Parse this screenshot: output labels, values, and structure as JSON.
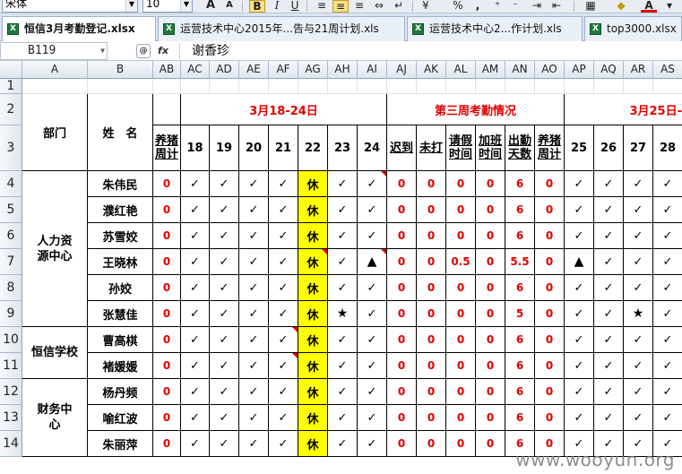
{
  "toolbar": {
    "font_name": "宋体",
    "font_size": "10",
    "grow_font": "A",
    "shrink_font": "A",
    "bold": "B",
    "percent": "%",
    "thousands": ",",
    "font_color_letter": "A"
  },
  "tabs": [
    {
      "label": "恒信3月考勤登记.xlsx",
      "active": true
    },
    {
      "label": "运营技术中心2015年...告与21周计划.xls",
      "active": false
    },
    {
      "label": "运营技术中心2...作计划.xls",
      "active": false
    },
    {
      "label": "top3000.xlsx",
      "active": false
    }
  ],
  "formula_bar": {
    "name_box": "B119",
    "fx_label": "fx",
    "content": "谢香珍"
  },
  "columns": [
    "A",
    "B",
    "AB",
    "AC",
    "AD",
    "AE",
    "AF",
    "AG",
    "AH",
    "AI",
    "AJ",
    "AK",
    "AL",
    "AM",
    "AN",
    "AO",
    "AP",
    "AQ",
    "AR",
    "AS"
  ],
  "rows": [
    "1",
    "2",
    "3",
    "4",
    "5",
    "6",
    "7",
    "8",
    "9",
    "10",
    "11",
    "12",
    "13",
    "14"
  ],
  "sheet": {
    "header_dept": "部门",
    "header_name": "姓　名",
    "week3_dates": "3月18-24日",
    "week3_summary": "第三周考勤情况",
    "week4_dates": "3月25日-",
    "col_labels": {
      "ab": "养猪周计",
      "ao": "养猪周计",
      "aj": "迟到",
      "ak": "未打",
      "al": "请假时间",
      "am": "加班时间",
      "an": "出勤天数"
    },
    "days_week3": [
      "18",
      "19",
      "20",
      "21",
      "22",
      "23",
      "24"
    ],
    "days_week4": [
      "25",
      "26",
      "27",
      "28"
    ],
    "departments": [
      {
        "label": "人力资源中心"
      },
      {
        "label": "恒信学校"
      },
      {
        "label": "财务中心"
      }
    ],
    "employees": [
      {
        "name": "朱伟民",
        "ab": "0",
        "w3": [
          "✓",
          "✓",
          "✓",
          "✓",
          "休",
          "✓",
          "✓"
        ],
        "aj": "0",
        "ak": "0",
        "al": "0",
        "am": "0",
        "an": "6",
        "ao": "0",
        "w4": [
          "✓",
          "✓",
          "✓",
          "✓"
        ]
      },
      {
        "name": "濮红艳",
        "ab": "0",
        "w3": [
          "✓",
          "✓",
          "✓",
          "✓",
          "休",
          "✓",
          "✓"
        ],
        "aj": "0",
        "ak": "0",
        "al": "0",
        "am": "0",
        "an": "6",
        "ao": "0",
        "w4": [
          "✓",
          "✓",
          "✓",
          "✓"
        ]
      },
      {
        "name": "苏雪姣",
        "ab": "0",
        "w3": [
          "✓",
          "✓",
          "✓",
          "✓",
          "休",
          "✓",
          "✓"
        ],
        "aj": "0",
        "ak": "0",
        "al": "0",
        "am": "0",
        "an": "6",
        "ao": "0",
        "w4": [
          "✓",
          "✓",
          "✓",
          "✓"
        ]
      },
      {
        "name": "王晓林",
        "ab": "0",
        "w3": [
          "✓",
          "✓",
          "✓",
          "✓",
          "休",
          "✓",
          "▲"
        ],
        "aj": "0",
        "ak": "0",
        "al": "0.5",
        "am": "0",
        "an": "5.5",
        "ao": "0",
        "w4": [
          "▲",
          "✓",
          "✓",
          "✓"
        ]
      },
      {
        "name": "孙姣",
        "ab": "0",
        "w3": [
          "✓",
          "✓",
          "✓",
          "✓",
          "休",
          "✓",
          "✓"
        ],
        "aj": "0",
        "ak": "0",
        "al": "0",
        "am": "0",
        "an": "6",
        "ao": "0",
        "w4": [
          "✓",
          "✓",
          "✓",
          "✓"
        ]
      },
      {
        "name": "张慧佳",
        "ab": "0",
        "w3": [
          "✓",
          "✓",
          "✓",
          "✓",
          "休",
          "★",
          "✓"
        ],
        "aj": "0",
        "ak": "0",
        "al": "0",
        "am": "0",
        "an": "5",
        "ao": "0",
        "w4": [
          "✓",
          "✓",
          "★",
          "✓"
        ]
      },
      {
        "name": "曹高棋",
        "ab": "0",
        "w3": [
          "✓",
          "✓",
          "✓",
          "✓",
          "休",
          "✓",
          "✓"
        ],
        "aj": "0",
        "ak": "0",
        "al": "0",
        "am": "0",
        "an": "6",
        "ao": "0",
        "w4": [
          "✓",
          "✓",
          "✓",
          "✓"
        ]
      },
      {
        "name": "褚媛媛",
        "ab": "0",
        "w3": [
          "✓",
          "✓",
          "✓",
          "✓",
          "休",
          "✓",
          "✓"
        ],
        "aj": "0",
        "ak": "0",
        "al": "0",
        "am": "0",
        "an": "6",
        "ao": "0",
        "w4": [
          "✓",
          "✓",
          "✓",
          "✓"
        ]
      },
      {
        "name": "杨丹频",
        "ab": "0",
        "w3": [
          "✓",
          "✓",
          "✓",
          "✓",
          "休",
          "✓",
          "✓"
        ],
        "aj": "0",
        "ak": "0",
        "al": "0",
        "am": "0",
        "an": "6",
        "ao": "0",
        "w4": [
          "✓",
          "✓",
          "✓",
          "✓"
        ]
      },
      {
        "name": "喻红波",
        "ab": "0",
        "w3": [
          "✓",
          "✓",
          "✓",
          "✓",
          "休",
          "✓",
          "✓"
        ],
        "aj": "0",
        "ak": "0",
        "al": "0",
        "am": "0",
        "an": "6",
        "ao": "0",
        "w4": [
          "✓",
          "✓",
          "✓",
          "✓"
        ]
      },
      {
        "name": "朱丽萍",
        "ab": "0",
        "w3": [
          "✓",
          "✓",
          "✓",
          "✓",
          "休",
          "✓",
          "✓"
        ],
        "aj": "0",
        "ak": "0",
        "al": "0",
        "am": "0",
        "an": "6",
        "ao": "0",
        "w4": [
          "✓",
          "✓",
          "✓",
          "✓"
        ]
      }
    ]
  },
  "watermark": "www.wooyun.org"
}
